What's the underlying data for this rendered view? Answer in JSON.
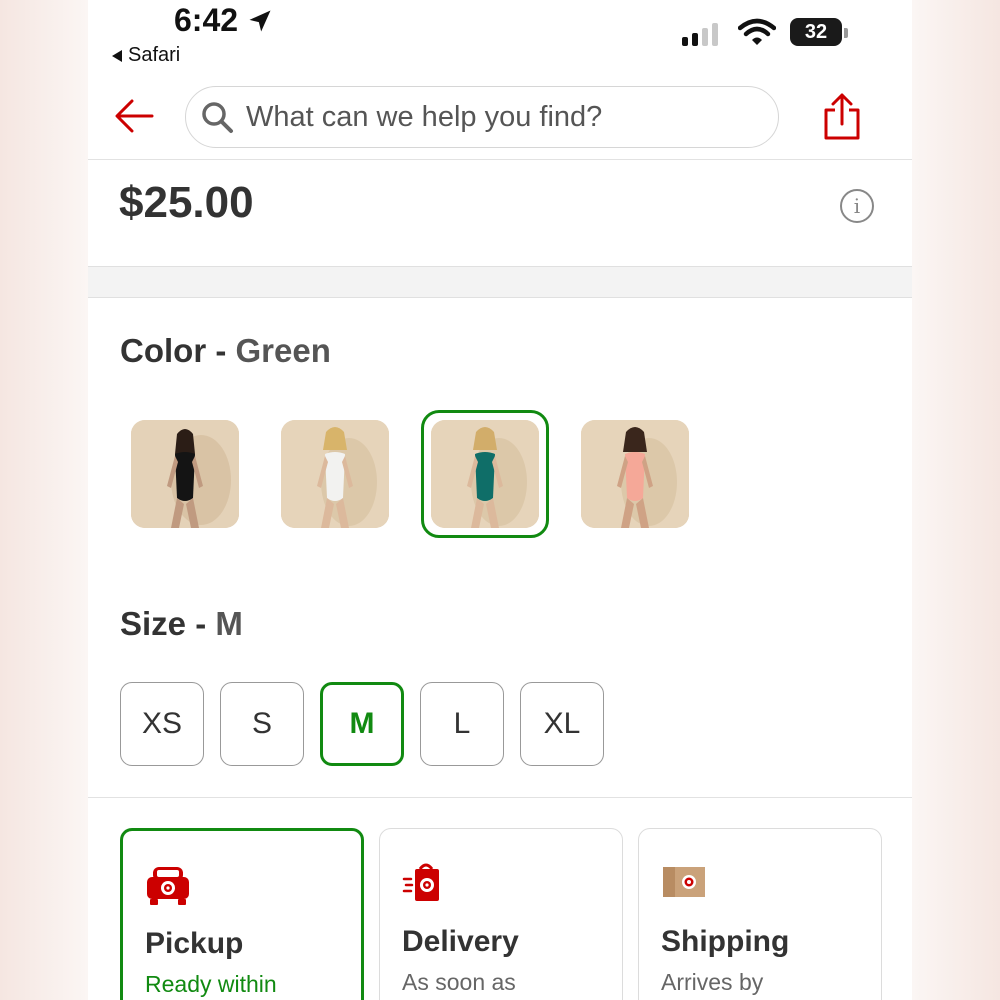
{
  "status_bar": {
    "time": "6:42",
    "back_app": "Safari",
    "battery": "32"
  },
  "header": {
    "search_placeholder": "What can we help you find?"
  },
  "product": {
    "price": "$25.00"
  },
  "color": {
    "label": "Color",
    "separator": " - ",
    "selected": "Green",
    "options": [
      "Black",
      "White",
      "Green",
      "Pink"
    ],
    "selected_index": 2
  },
  "size": {
    "label": "Size",
    "separator": " - ",
    "selected": "M",
    "options": [
      "XS",
      "S",
      "M",
      "L",
      "XL"
    ]
  },
  "fulfillment": [
    {
      "title": "Pickup",
      "subtitle": "Ready within",
      "icon": "pickup-car-icon"
    },
    {
      "title": "Delivery",
      "subtitle": "As soon as",
      "icon": "delivery-bag-icon"
    },
    {
      "title": "Shipping",
      "subtitle": "Arrives by",
      "icon": "shipping-box-icon"
    }
  ],
  "colors": {
    "accent_red": "#cc0000",
    "selected_green": "#118a11",
    "swatch_bg": "#e4d2b8"
  }
}
